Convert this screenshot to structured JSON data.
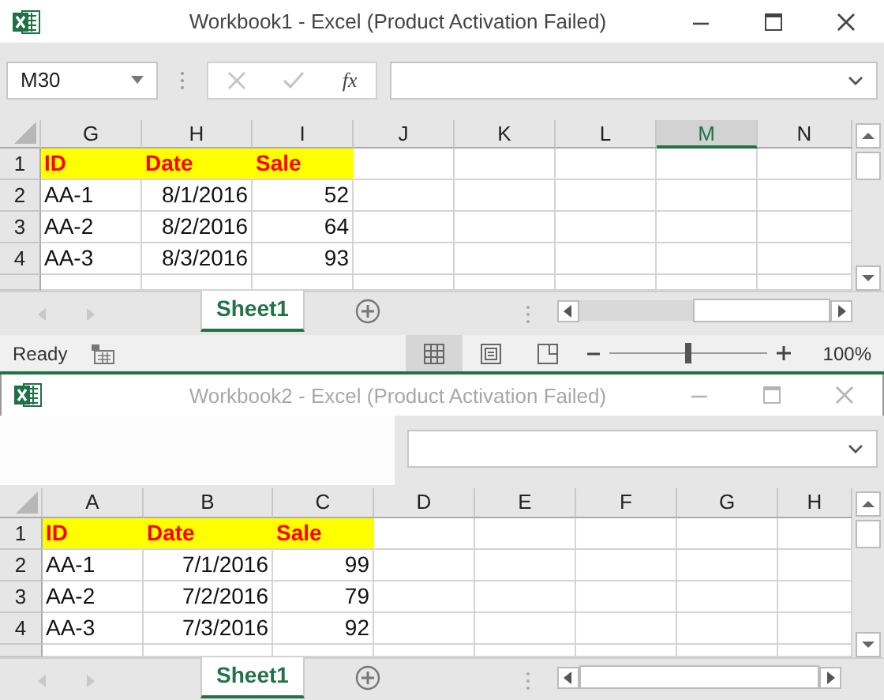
{
  "windows": [
    {
      "title": "Workbook1 - Excel (Product Activation Failed)",
      "active": true,
      "name_box": "M30",
      "function_label": "fx",
      "columns": [
        {
          "label": "G",
          "selected": false
        },
        {
          "label": "H",
          "selected": false
        },
        {
          "label": "I",
          "selected": false
        },
        {
          "label": "J",
          "selected": false
        },
        {
          "label": "K",
          "selected": false
        },
        {
          "label": "L",
          "selected": false
        },
        {
          "label": "M",
          "selected": true
        },
        {
          "label": "N",
          "selected": false
        }
      ],
      "rows": [
        {
          "header": "1",
          "cells": [
            {
              "text": "ID",
              "kind": "heading"
            },
            {
              "text": "Date",
              "kind": "heading"
            },
            {
              "text": "Sale",
              "kind": "heading"
            }
          ]
        },
        {
          "header": "2",
          "cells": [
            {
              "text": "AA-1",
              "kind": "text"
            },
            {
              "text": "8/1/2016",
              "kind": "number"
            },
            {
              "text": "52",
              "kind": "number"
            }
          ]
        },
        {
          "header": "3",
          "cells": [
            {
              "text": "AA-2",
              "kind": "text"
            },
            {
              "text": "8/2/2016",
              "kind": "number"
            },
            {
              "text": "64",
              "kind": "number"
            }
          ]
        },
        {
          "header": "4",
          "cells": [
            {
              "text": "AA-3",
              "kind": "text"
            },
            {
              "text": "8/3/2016",
              "kind": "number"
            },
            {
              "text": "93",
              "kind": "number"
            }
          ]
        }
      ],
      "sheet_tab": {
        "label": "Sheet1",
        "selected": true
      },
      "status_bar": {
        "text": "Ready",
        "views": [
          {
            "selected": true
          },
          {
            "selected": false
          },
          {
            "selected": false
          }
        ],
        "zoom": {
          "level": 0.5,
          "reading": "100%"
        }
      }
    },
    {
      "title": "Workbook2 - Excel (Product Activation Failed)",
      "active": false,
      "columns": [
        {
          "label": "A",
          "selected": false
        },
        {
          "label": "B",
          "selected": false
        },
        {
          "label": "C",
          "selected": false
        },
        {
          "label": "D",
          "selected": false
        },
        {
          "label": "E",
          "selected": false
        },
        {
          "label": "F",
          "selected": false
        },
        {
          "label": "G",
          "selected": false
        },
        {
          "label": "H",
          "selected": false
        }
      ],
      "rows": [
        {
          "header": "1",
          "cells": [
            {
              "text": "ID",
              "kind": "heading"
            },
            {
              "text": "Date",
              "kind": "heading"
            },
            {
              "text": "Sale",
              "kind": "heading"
            }
          ]
        },
        {
          "header": "2",
          "cells": [
            {
              "text": "AA-1",
              "kind": "text"
            },
            {
              "text": "7/1/2016",
              "kind": "number"
            },
            {
              "text": "99",
              "kind": "number"
            }
          ]
        },
        {
          "header": "3",
          "cells": [
            {
              "text": "AA-2",
              "kind": "text"
            },
            {
              "text": "7/2/2016",
              "kind": "number"
            },
            {
              "text": "79",
              "kind": "number"
            }
          ]
        },
        {
          "header": "4",
          "cells": [
            {
              "text": "AA-3",
              "kind": "text"
            },
            {
              "text": "7/3/2016",
              "kind": "number"
            },
            {
              "text": "92",
              "kind": "number"
            }
          ]
        }
      ],
      "sheet_tab": {
        "label": "Sheet1",
        "selected": true
      }
    }
  ]
}
